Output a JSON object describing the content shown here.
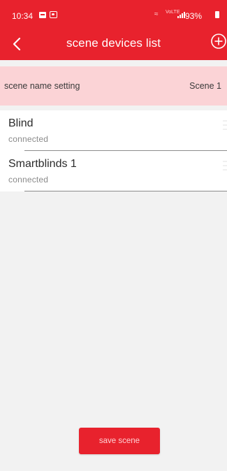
{
  "status_bar": {
    "time": "10:34",
    "network": "VoLTE",
    "battery": "93%"
  },
  "header": {
    "title": "scene devices list"
  },
  "scene_setting": {
    "label": "scene name setting",
    "value": "Scene 1"
  },
  "devices": [
    {
      "name": "Blind",
      "status": "connected"
    },
    {
      "name": "Smartblinds 1",
      "status": "connected"
    }
  ],
  "footer": {
    "save_label": "save scene"
  },
  "colors": {
    "brand": "#e8222d",
    "scene_row_bg": "#fbd3d6",
    "page_bg": "#f2f2f2"
  }
}
